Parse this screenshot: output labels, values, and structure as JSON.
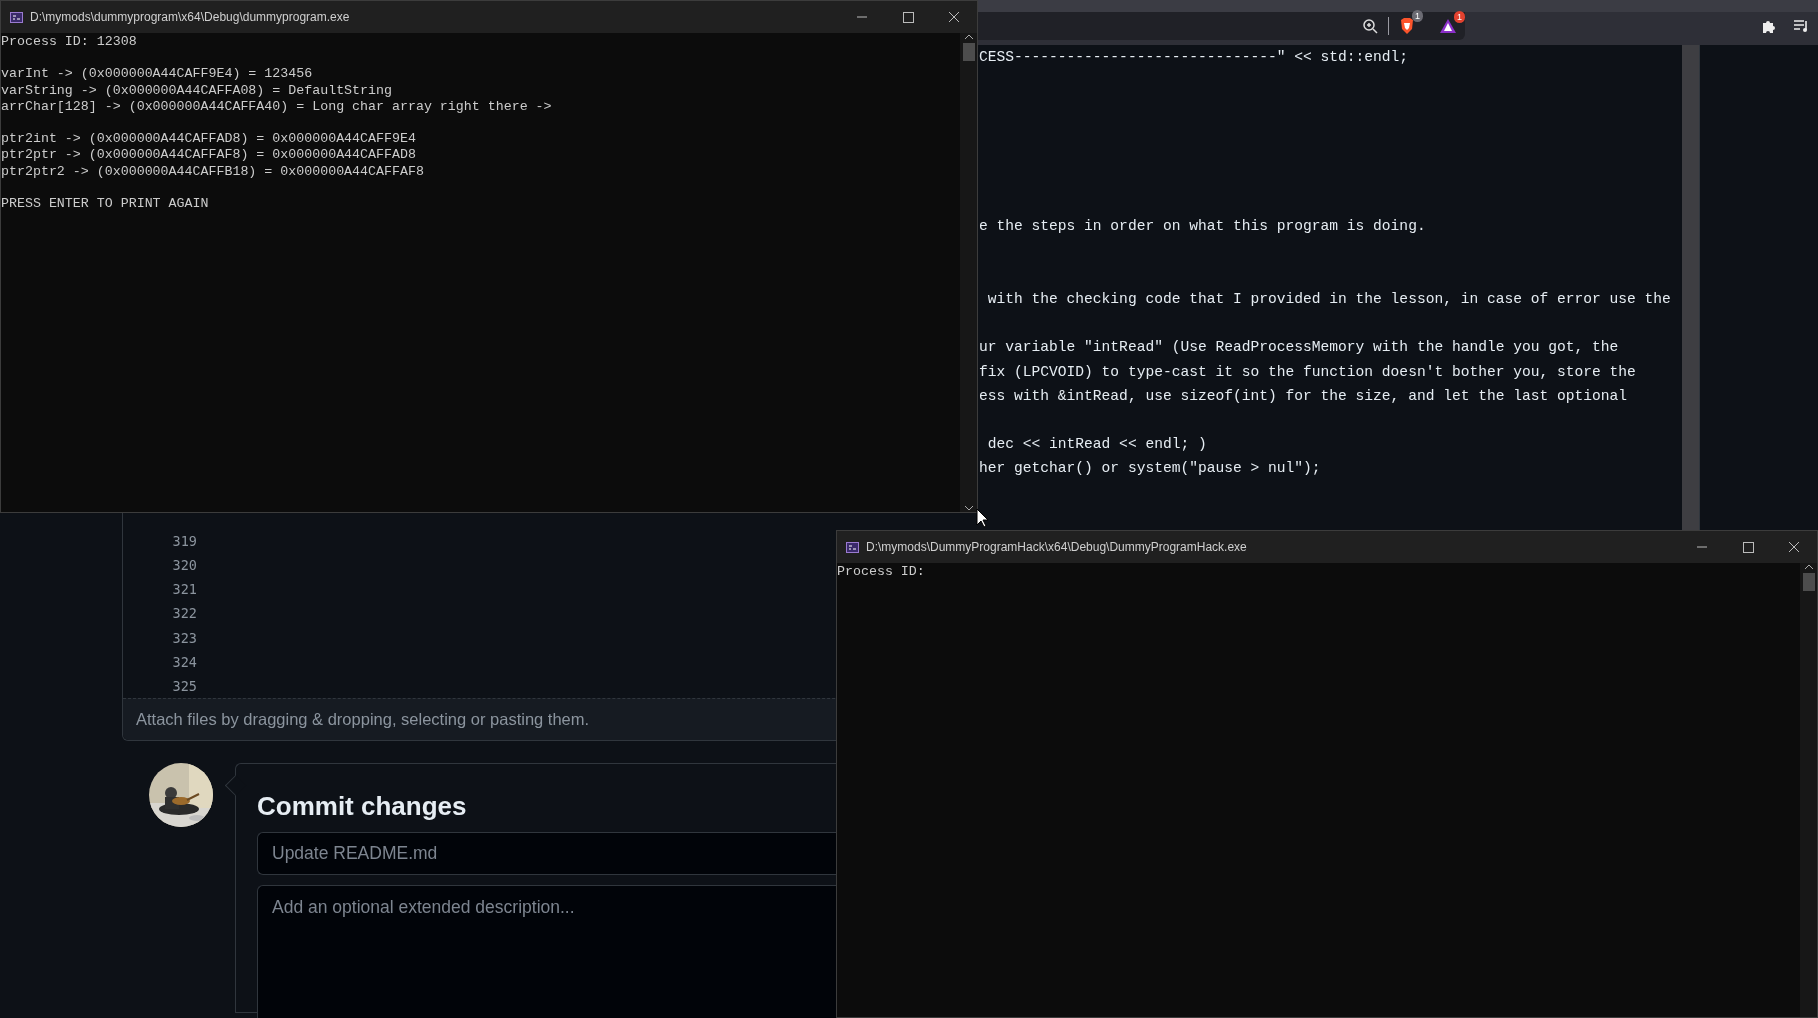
{
  "browser_toolbar": {
    "extension_badges": [
      {
        "kind": "brave",
        "count": "1"
      },
      {
        "kind": "rewards",
        "count": "1"
      }
    ]
  },
  "editor": {
    "rows": [
      {
        "kind": "fragment",
        "text": "CESS------------------------------\" << std::endl;"
      },
      {
        "kind": "blank"
      },
      {
        "kind": "blank"
      },
      {
        "kind": "blank"
      },
      {
        "kind": "blank"
      },
      {
        "kind": "blank"
      },
      {
        "kind": "blank"
      },
      {
        "kind": "fragment",
        "text": "e the steps in order on what this program is doing."
      },
      {
        "kind": "blank"
      },
      {
        "kind": "blank"
      },
      {
        "kind": "fragment",
        "text": " with the checking code that I provided in the lesson, in case of error use the"
      },
      {
        "kind": "blank"
      },
      {
        "kind": "fragment",
        "text": "ur variable \"intRead\" (Use ReadProcessMemory with the handle you got, the"
      },
      {
        "kind": "fragment",
        "text": "fix (LPCVOID) to type-cast it so the function doesn't bother you, store the"
      },
      {
        "kind": "fragment",
        "text": "ess with &intRead, use sizeof(int) for the size, and let the last optional"
      },
      {
        "kind": "blank"
      },
      {
        "kind": "fragment",
        "text": " dec << intRead << endl; )"
      },
      {
        "kind": "fragment",
        "text": "her getchar() or system(\"pause > nul\");"
      },
      {
        "kind": "blank"
      },
      {
        "kind": "blank"
      },
      {
        "kind": "line",
        "number": "319"
      },
      {
        "kind": "line",
        "number": "320"
      },
      {
        "kind": "line",
        "number": "321"
      },
      {
        "kind": "line",
        "number": "322"
      },
      {
        "kind": "line",
        "number": "323"
      },
      {
        "kind": "line",
        "number": "324"
      },
      {
        "kind": "line",
        "number": "325"
      }
    ],
    "attach_hint": "Attach files by dragging & dropping, selecting or pasting them."
  },
  "commit": {
    "heading": "Commit changes",
    "summary": {
      "placeholder": "Update README.md"
    },
    "description": {
      "placeholder": "Add an optional extended description..."
    }
  },
  "windows": [
    {
      "title": "D:\\mymods\\dummyprogram\\x64\\Debug\\dummyprogram.exe",
      "blocks": [
        [
          "Process ID: 12308"
        ],
        [
          "varInt -> (0x000000A44CAFF9E4) = 123456",
          "varString -> (0x000000A44CAFFA08) = DefaultString",
          "arrChar[128] -> (0x000000A44CAFFA40) = Long char array right there ->"
        ],
        [
          "ptr2int -> (0x000000A44CAFFAD8) = 0x000000A44CAFF9E4",
          "ptr2ptr -> (0x000000A44CAFFAF8) = 0x000000A44CAFFAD8",
          "ptr2ptr2 -> (0x000000A44CAFFB18) = 0x000000A44CAFFAF8"
        ],
        [
          "PRESS ENTER TO PRINT AGAIN"
        ]
      ]
    },
    {
      "title": "D:\\mymods\\DummyProgramHack\\x64\\Debug\\DummyProgramHack.exe",
      "blocks": [
        [
          "Process ID:"
        ]
      ]
    }
  ]
}
